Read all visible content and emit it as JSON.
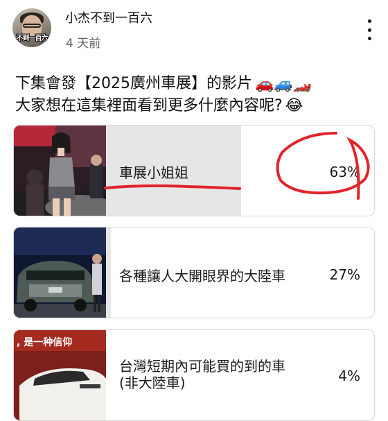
{
  "channel": {
    "name": "小杰不到一百六",
    "avatar_tag": "不到一百六",
    "time_ago": "4 天前"
  },
  "post": {
    "line1": "下集會發【2025廣州車展】的影片",
    "line1_emoji": "🚗🚙🏎️",
    "line2": "大家想在這集裡面看到更多什麼內容呢?",
    "line2_emoji": "😂"
  },
  "poll": {
    "options": [
      {
        "label": "車展小姐姐",
        "percent": 63,
        "percent_text": "63%"
      },
      {
        "label": "各種讓人大開眼界的大陸車",
        "percent": 27,
        "percent_text": "27%"
      },
      {
        "label": "台灣短期內可能買的到的車",
        "label2": "(非大陸車)",
        "percent": 4,
        "percent_text": "4%"
      }
    ],
    "thumb3_caption": ", 是一种信仰"
  },
  "colors": {
    "fill": "#e6e6e6",
    "annotation": "#e0242a",
    "border": "#d8d8d8"
  },
  "icons": [
    "kebab-menu-icon",
    "avatar-image",
    "car-emoji",
    "laugh-emoji"
  ]
}
